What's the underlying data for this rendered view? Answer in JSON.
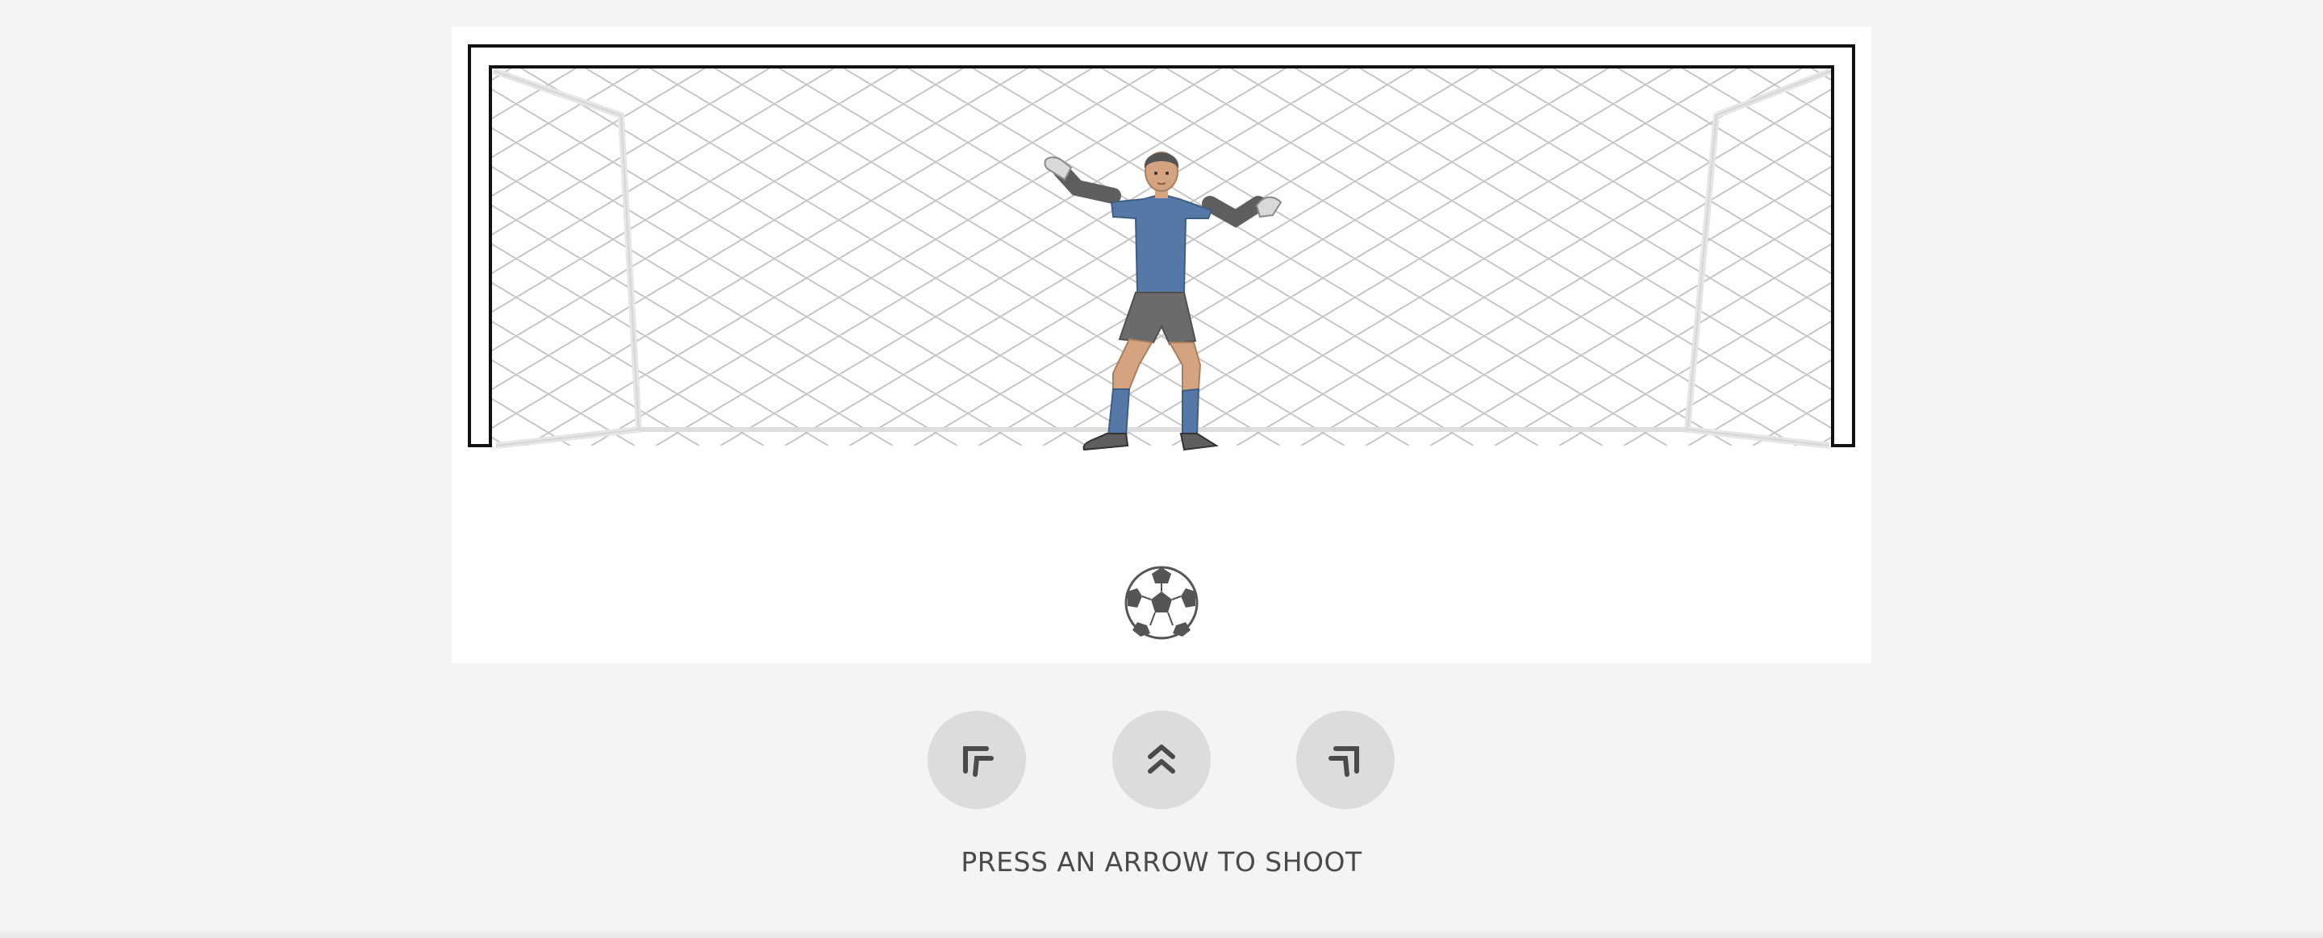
{
  "game": {
    "instruction": "PRESS AN ARROW TO SHOOT",
    "controls": [
      {
        "id": "shoot-left",
        "icon": "arrow-up-left-icon"
      },
      {
        "id": "shoot-center",
        "icon": "double-chevron-up-icon"
      },
      {
        "id": "shoot-right",
        "icon": "arrow-up-right-icon"
      }
    ]
  },
  "colors": {
    "page_background": "#f4f4f4",
    "field_background": "#ffffff",
    "goal_frame": "#111111",
    "net": "#c4c4c4",
    "jersey": "#5578a6",
    "shorts": "#6b6b6b",
    "skin": "#d4a37f",
    "button": "#dcdcdc",
    "icon": "#4a4a4a",
    "text": "#4a4a4a"
  }
}
